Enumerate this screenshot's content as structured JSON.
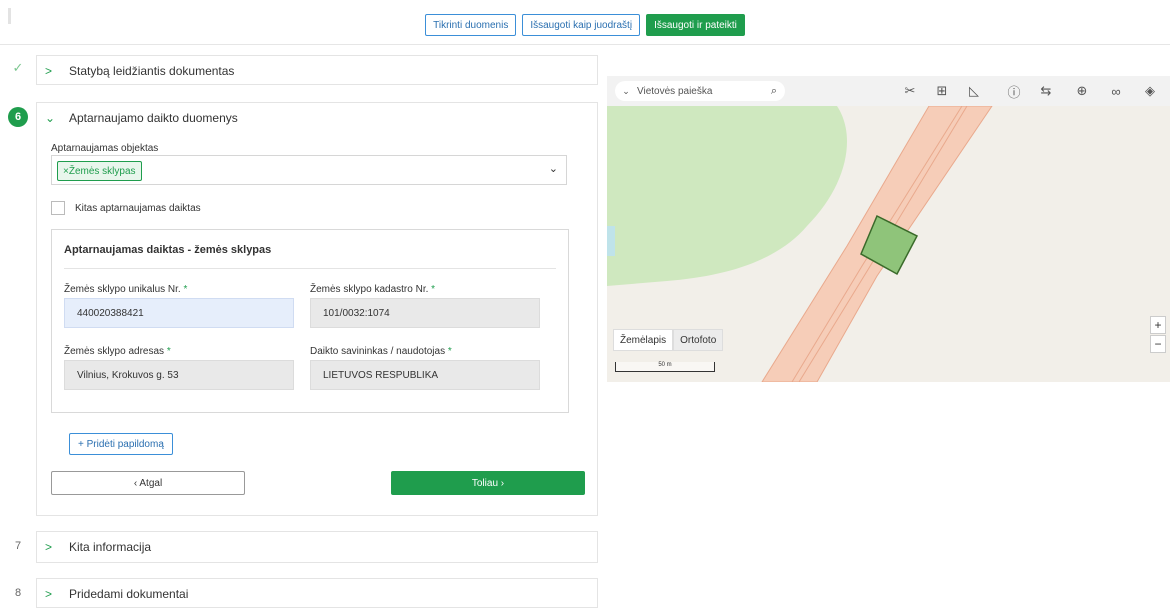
{
  "toolbar": {
    "check_label": "Tikrinti duomenis",
    "draft_label": "Išsaugoti kaip juodraštį",
    "submit_label": "Išsaugoti ir pateikti"
  },
  "steps": [
    {
      "num": "✓",
      "title": "Statybą leidžiantis dokumentas",
      "state": "done"
    },
    {
      "num": "6",
      "title": "Aptarnaujamo daikto duomenys",
      "state": "active"
    },
    {
      "num": "7",
      "title": "Kita informacija",
      "state": "collapsed"
    },
    {
      "num": "8",
      "title": "Pridedami dokumentai",
      "state": "collapsed"
    }
  ],
  "form": {
    "object_label": "Aptarnaujamas objektas",
    "object_tag": "Žemės sklypas",
    "other_checkbox_label": "Kitas aptarnaujamas daiktas",
    "sub_title": "Aptarnaujamas daiktas - žemės sklypas",
    "unique_label": "Žemės sklypo unikalus Nr.",
    "unique_value": "440020388421",
    "cadastre_label": "Žemės sklypo kadastro Nr.",
    "cadastre_value": "101/0032:1074",
    "address_label": "Žemės sklypo adresas",
    "address_value": "Vilnius, Krokuvos g. 53",
    "owner_label": "Daikto savininkas / naudotojas",
    "owner_value": "LIETUVOS RESPUBLIKA",
    "required_mark": "*",
    "add_label": "+ Pridėti papildomą",
    "back_label": "‹ Atgal",
    "next_label": "Toliau ›"
  },
  "map": {
    "search_placeholder": "Vietovės paieška",
    "layer_map": "Žemėlapis",
    "layer_ortho": "Ortofoto",
    "scale_label": "50 m",
    "zoom_in": "+",
    "zoom_out": "−",
    "tools": [
      "measure-cross-icon",
      "add-document-icon",
      "angle-icon",
      "info-icon",
      "link-arrow-icon",
      "add-file-icon",
      "link-icon",
      "layers-icon"
    ],
    "colors": {
      "forest": "#cfe8bf",
      "road": "#f6cdb8",
      "parcel": "#8fc47a"
    }
  }
}
